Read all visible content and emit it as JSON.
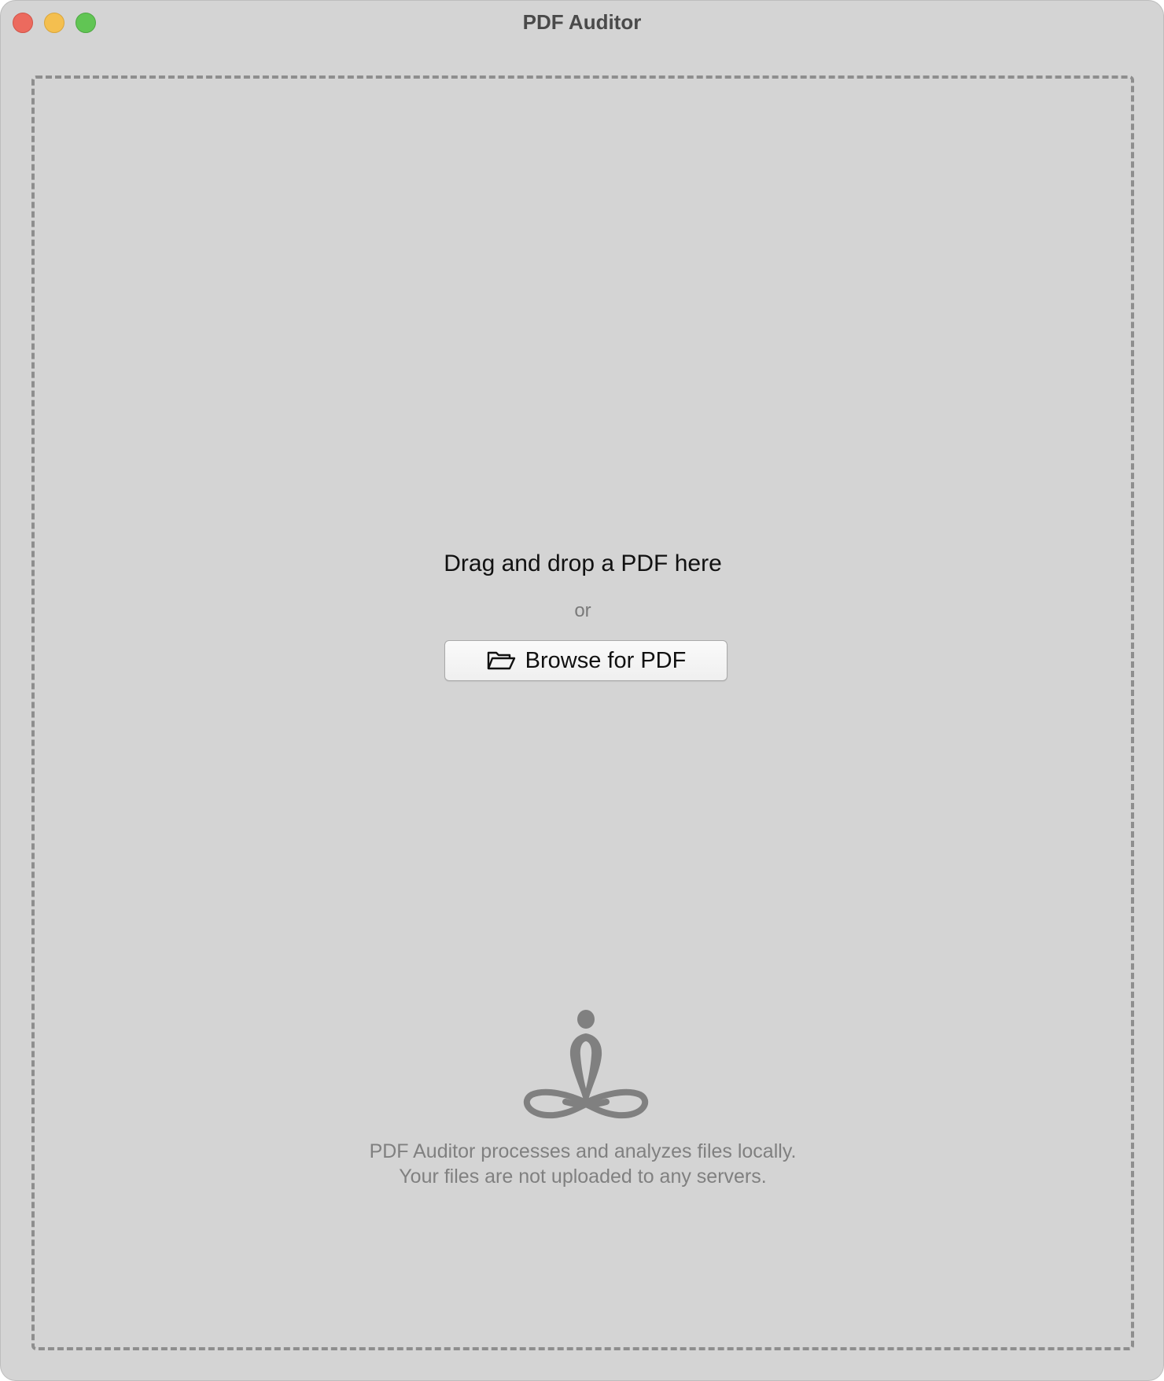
{
  "window": {
    "title": "PDF Auditor"
  },
  "dropzone": {
    "title": "Drag and drop a PDF here",
    "separator": "or",
    "browse_button": {
      "label": "Browse for PDF",
      "icon": "folder-open-icon"
    },
    "privacy_icon": "meditation-icon",
    "privacy_lines": [
      "PDF Auditor processes and analyzes files locally.",
      "Your files are not uploaded to any servers."
    ]
  },
  "colors": {
    "background": "#d4d4d4",
    "dashed_border": "#8e8e8e",
    "muted_text": "#808080",
    "close": "#ec6a5e",
    "minimize": "#f4bf4f",
    "zoom": "#61c554"
  }
}
